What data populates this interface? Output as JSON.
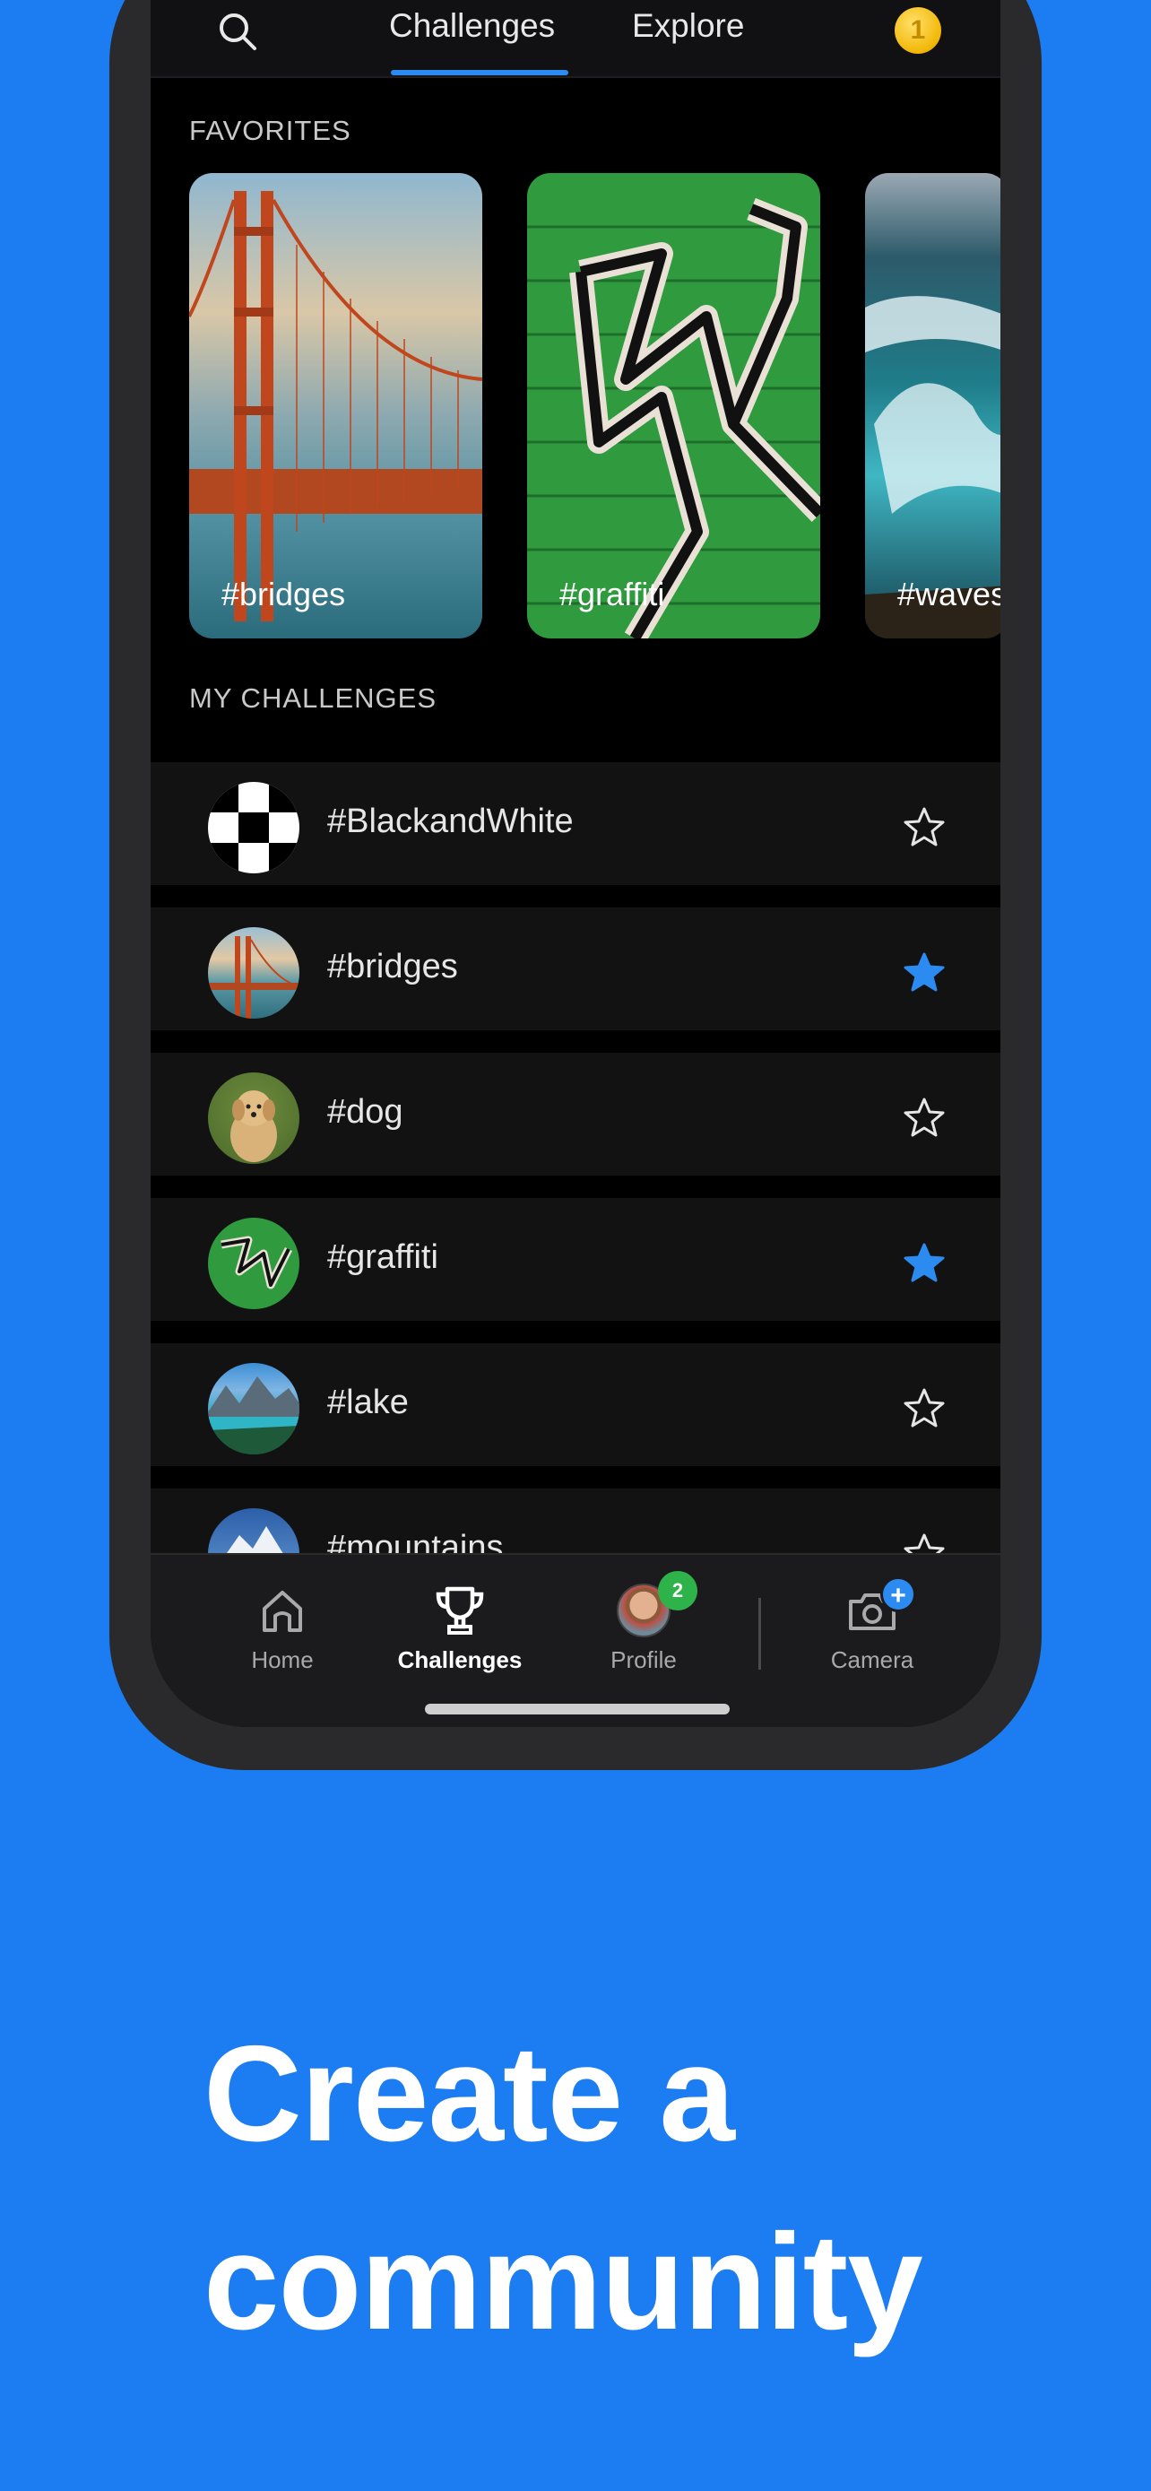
{
  "top_nav": {
    "tabs": [
      {
        "label": "Challenges",
        "active": true
      },
      {
        "label": "Explore",
        "active": false
      }
    ],
    "coin_count": "1"
  },
  "favorites": {
    "section_label": "FAVORITES",
    "items": [
      {
        "label": "#bridges"
      },
      {
        "label": "#graffiti"
      },
      {
        "label": "#waves"
      }
    ]
  },
  "my_challenges": {
    "section_label": "MY CHALLENGES",
    "items": [
      {
        "label": "#BlackandWhite",
        "favorited": false
      },
      {
        "label": "#bridges",
        "favorited": true
      },
      {
        "label": "#dog",
        "favorited": false
      },
      {
        "label": "#graffiti",
        "favorited": true
      },
      {
        "label": "#lake",
        "favorited": false
      },
      {
        "label": "#mountains",
        "favorited": false
      }
    ]
  },
  "bottom_nav": {
    "items": [
      {
        "label": "Home",
        "icon": "home-icon",
        "active": false
      },
      {
        "label": "Challenges",
        "icon": "trophy-icon",
        "active": true
      },
      {
        "label": "Profile",
        "icon": "avatar",
        "active": false,
        "badge": "2"
      },
      {
        "label": "Camera",
        "icon": "camera-icon",
        "active": false,
        "badge": "+"
      }
    ]
  },
  "headline": {
    "line1": "Create a",
    "line2": "community"
  },
  "colors": {
    "background": "#1c7cf2",
    "accent": "#2b8bf0",
    "star_active": "#2b8bf0",
    "badge_green": "#2db34a"
  }
}
